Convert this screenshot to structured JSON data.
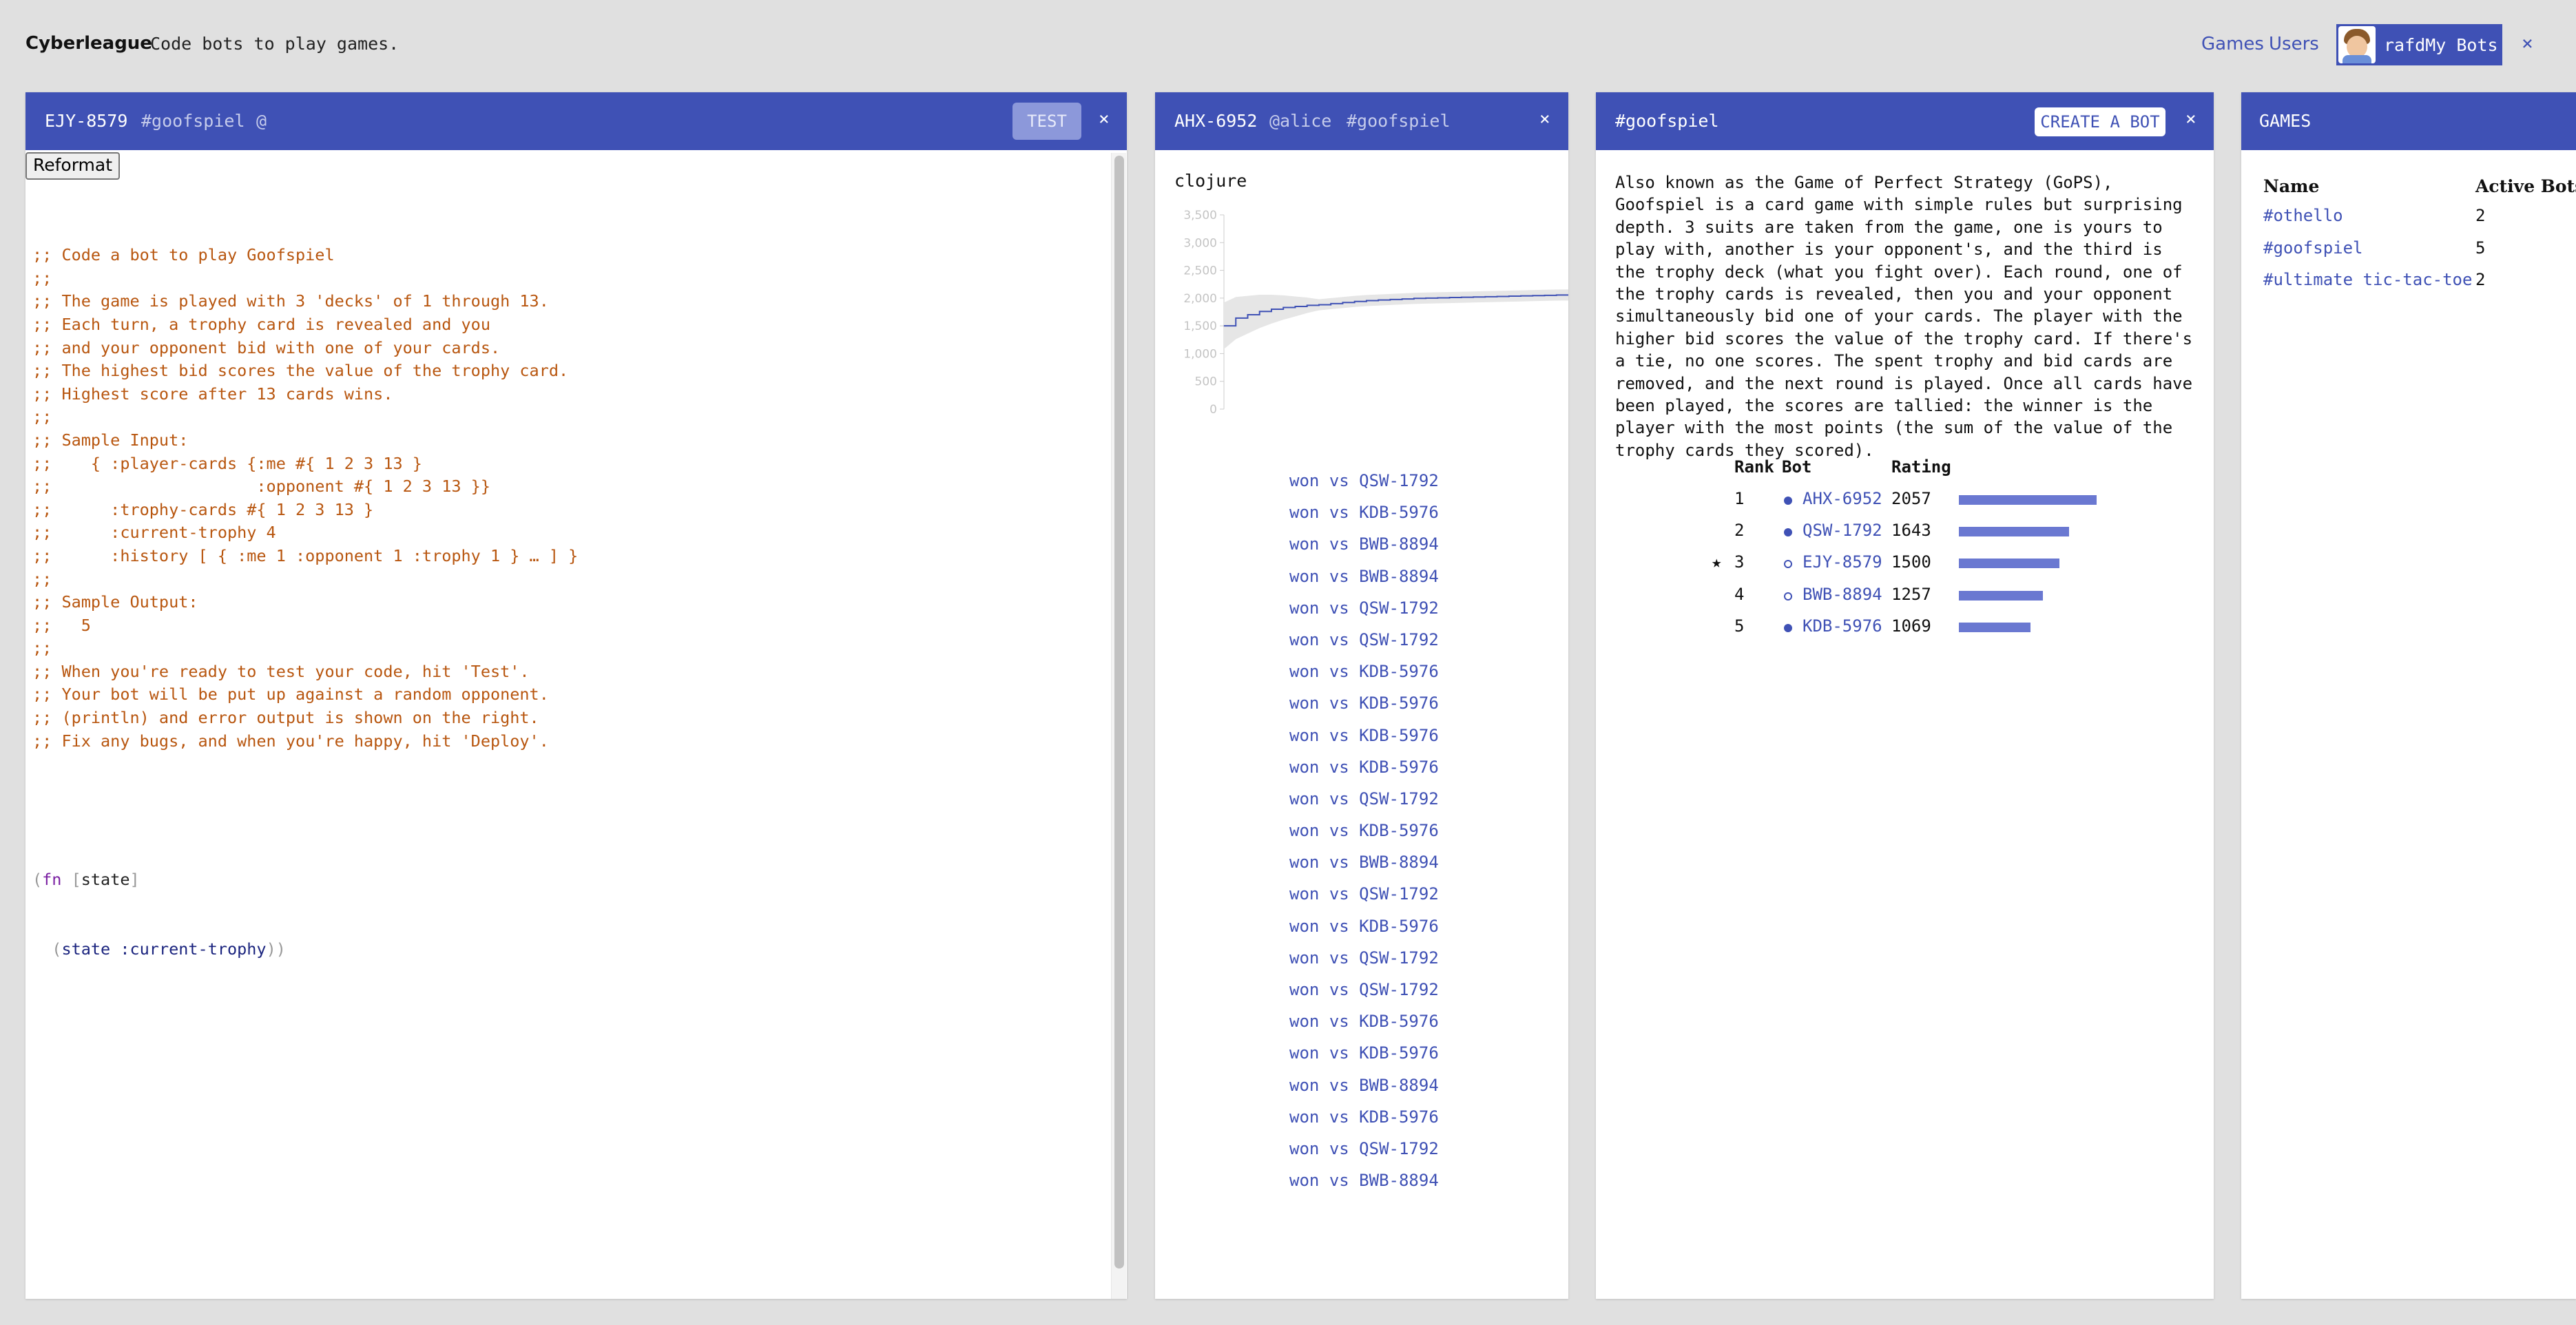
{
  "header": {
    "brand": "Cyberleague",
    "tagline": "Code bots to play games.",
    "nav_games": "Games",
    "nav_users": "Users",
    "user_name": "rafd",
    "my_bots": "My Bots",
    "close": "×"
  },
  "editor": {
    "bot_id": "EJY-8579",
    "game_tag": "#goofspiel",
    "at_symbol": "@",
    "test_label": "TEST",
    "close": "×",
    "reformat_label": "Reformat",
    "comment_lines": [
      ";; Code a bot to play Goofspiel",
      ";;",
      ";; The game is played with 3 'decks' of 1 through 13.",
      ";; Each turn, a trophy card is revealed and you",
      ";; and your opponent bid with one of your cards.",
      ";; The highest bid scores the value of the trophy card.",
      ";; Highest score after 13 cards wins.",
      ";;",
      ";; Sample Input:",
      ";;    { :player-cards {:me #{ 1 2 3 13 }",
      ";;                     :opponent #{ 1 2 3 13 }}",
      ";;      :trophy-cards #{ 1 2 3 13 }",
      ";;      :current-trophy 4",
      ";;      :history [ { :me 1 :opponent 1 :trophy 1 } … ] }",
      ";;",
      ";; Sample Output:",
      ";;   5",
      ";;",
      ";; When you're ready to test your code, hit 'Test'.",
      ";; Your bot will be put up against a random opponent.",
      ";; (println) and error output is shown on the right.",
      ";; Fix any bugs, and when you're happy, hit 'Deploy'."
    ],
    "code_fn": "fn",
    "code_arg": "state",
    "code_body_sym": "state",
    "code_body_key": ":current-trophy"
  },
  "bot_panel": {
    "bot_id": "AHX-6952",
    "owner": "@alice",
    "game_tag": "#goofspiel",
    "close": "×",
    "language": "clojure",
    "chart_data": {
      "type": "line",
      "title": "",
      "xlabel": "",
      "ylabel": "",
      "ylim": [
        0,
        3500
      ],
      "y_ticks": [
        "0",
        "500",
        "1,000",
        "1,500",
        "2,000",
        "2,500",
        "3,000",
        "3,500"
      ],
      "series": [
        {
          "values": [
            1500,
            1640,
            1700,
            1760,
            1800,
            1830,
            1850,
            1870,
            1880,
            1900,
            1920,
            1940,
            1955,
            1965,
            1975,
            1985,
            1995,
            2000,
            2005,
            2010,
            2015,
            2020,
            2025,
            2030,
            2035,
            2040,
            2045,
            2050,
            2055,
            2057
          ]
        }
      ]
    },
    "match_won": "won",
    "match_vs": "vs",
    "matches": [
      "QSW-1792",
      "KDB-5976",
      "BWB-8894",
      "BWB-8894",
      "QSW-1792",
      "QSW-1792",
      "KDB-5976",
      "KDB-5976",
      "KDB-5976",
      "KDB-5976",
      "QSW-1792",
      "KDB-5976",
      "BWB-8894",
      "QSW-1792",
      "KDB-5976",
      "QSW-1792",
      "QSW-1792",
      "KDB-5976",
      "KDB-5976",
      "BWB-8894",
      "KDB-5976",
      "QSW-1792",
      "BWB-8894"
    ]
  },
  "game_panel": {
    "game_tag": "#goofspiel",
    "create_label": "CREATE A BOT",
    "close": "×",
    "description": "Also known as the Game of Perfect Strategy (GoPS), Goofspiel is a card game with simple rules but surprising depth. 3 suits are taken from the game, one is yours to play with, another is your opponent's, and the third is the trophy deck (what you fight over). Each round, one of the trophy cards is revealed, then you and your opponent simultaneously bid one of your cards. The player with the higher bid scores the value of the trophy card. If there's a tie, no one scores. The spent trophy and bid cards are removed, and the next round is played. Once all cards have been played, the scores are tallied: the winner is the player with the most points (the sum of the value of the trophy cards they scored).",
    "ranking_headers": {
      "rank": "Rank",
      "bot": "Bot",
      "rating": "Rating"
    },
    "star": "★",
    "rankings": [
      {
        "rank": "1",
        "bot": "AHX-6952",
        "rating": 2057,
        "active": true,
        "mine": false
      },
      {
        "rank": "2",
        "bot": "QSW-1792",
        "rating": 1643,
        "active": true,
        "mine": false
      },
      {
        "rank": "3",
        "bot": "EJY-8579",
        "rating": 1500,
        "active": false,
        "mine": true
      },
      {
        "rank": "4",
        "bot": "BWB-8894",
        "rating": 1257,
        "active": false,
        "mine": false
      },
      {
        "rank": "5",
        "bot": "KDB-5976",
        "rating": 1069,
        "active": true,
        "mine": false
      }
    ],
    "accent_color": "#3f51b5",
    "bar_color": "#6a78d1"
  },
  "games_panel": {
    "title": "GAMES",
    "col_name": "Name",
    "col_active": "Active Bots",
    "games": [
      {
        "name": "#othello",
        "active": "2"
      },
      {
        "name": "#goofspiel",
        "active": "5"
      },
      {
        "name": "#ultimate tic-tac-toe",
        "active": "2"
      }
    ]
  }
}
